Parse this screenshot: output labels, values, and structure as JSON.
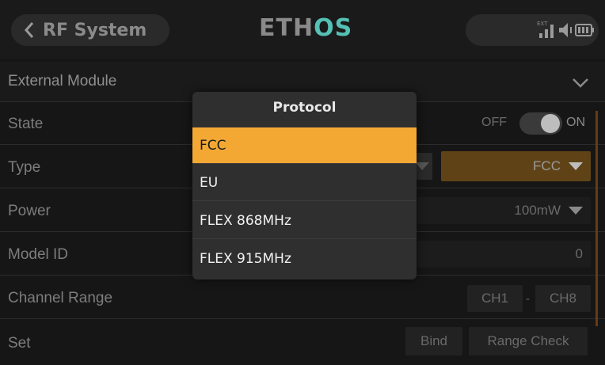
{
  "header": {
    "title": "RF System",
    "logo_main": "ETH",
    "logo_accent": "OS",
    "ext_label": "EXT"
  },
  "section": {
    "label": "External Module"
  },
  "rows": {
    "state": {
      "label": "State",
      "off": "OFF",
      "on": "ON"
    },
    "type": {
      "label": "Type",
      "value": "FCC"
    },
    "power": {
      "label": "Power",
      "value": "100mW"
    },
    "model_id": {
      "label": "Model ID",
      "value": "0"
    },
    "channel_range": {
      "label": "Channel Range",
      "start": "CH1",
      "end": "CH8",
      "sep": "-"
    },
    "set": {
      "label": "Set",
      "bind": "Bind",
      "range_check": "Range Check"
    }
  },
  "popup": {
    "title": "Protocol",
    "options": [
      "FCC",
      "EU",
      "FLEX 868MHz",
      "FLEX 915MHz"
    ],
    "selected": "FCC"
  },
  "colors": {
    "accent": "#f4a834",
    "logo_accent": "#55c0b4",
    "type_value_bg": "#5f4317"
  }
}
